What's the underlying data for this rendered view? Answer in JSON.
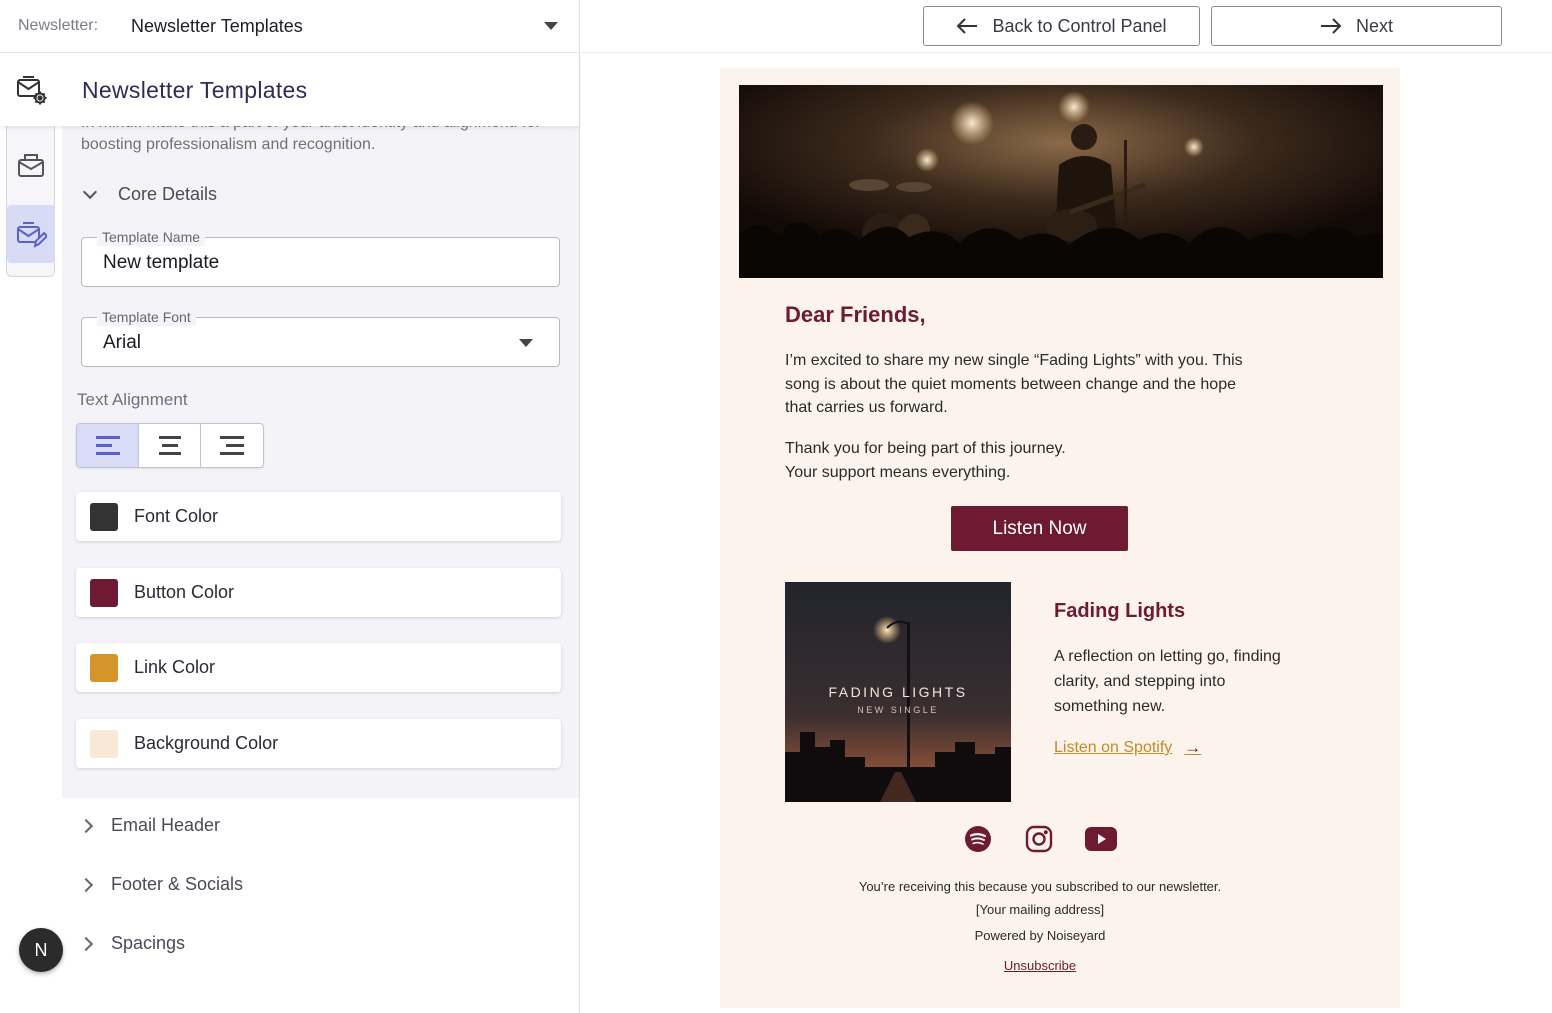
{
  "topbar": {
    "label": "Newsletter:",
    "selected": "Newsletter Templates"
  },
  "panel": {
    "title": "Newsletter Templates",
    "description": "In mind.. make this a part of your artist identity and alignment. for boosting professionalism and recognition.",
    "core_details_label": "Core Details",
    "template_name_label": "Template Name",
    "template_name_value": "New template",
    "template_font_label": "Template Font",
    "template_font_value": "Arial",
    "text_alignment_label": "Text Alignment",
    "alignment_options": [
      "align-left",
      "align-center",
      "align-right"
    ],
    "alignment_selected": "align-left",
    "colors": [
      {
        "label": "Font Color",
        "hex": "#333333"
      },
      {
        "label": "Button Color",
        "hex": "#6e1a33"
      },
      {
        "label": "Link Color",
        "hex": "#d4962a"
      },
      {
        "label": "Background Color",
        "hex": "#f8e8d6"
      }
    ],
    "sections": [
      "Email Header",
      "Footer & Socials",
      "Spacings"
    ]
  },
  "user": {
    "initial": "N"
  },
  "actions": {
    "back_label": "Back to Control Panel",
    "next_label": "Next"
  },
  "email": {
    "greeting": "Dear Friends,",
    "paragraph1": "I’m excited to share my new single “Fading Lights” with you. This song is about the quiet moments between change and the hope that carries us forward.",
    "paragraph2_line1": "Thank you for being part of this journey.",
    "paragraph2_line2": "Your support means everything.",
    "cta_label": "Listen Now",
    "album_art_title": "FADING LIGHTS",
    "album_art_subtitle": "NEW SINGLE",
    "song_title": "Fading Lights",
    "song_description": "A reflection on letting go, finding clarity, and stepping into something new.",
    "spotify_link": "Listen on Spotify",
    "social_icons": [
      "spotify-icon",
      "instagram-icon",
      "youtube-icon"
    ],
    "footer_notice": "You’re receiving this because you subscribed to our newsletter.",
    "footer_address": "[Your mailing address]",
    "footer_powered": "Powered by Noiseyard",
    "footer_unsubscribe": "Unsubscribe"
  },
  "theme": {
    "accent": "#2f2a5a",
    "selected_tab_bg": "#d8dbf6",
    "email_bg": "#fcf4ec",
    "brand": "#6e1a33"
  }
}
